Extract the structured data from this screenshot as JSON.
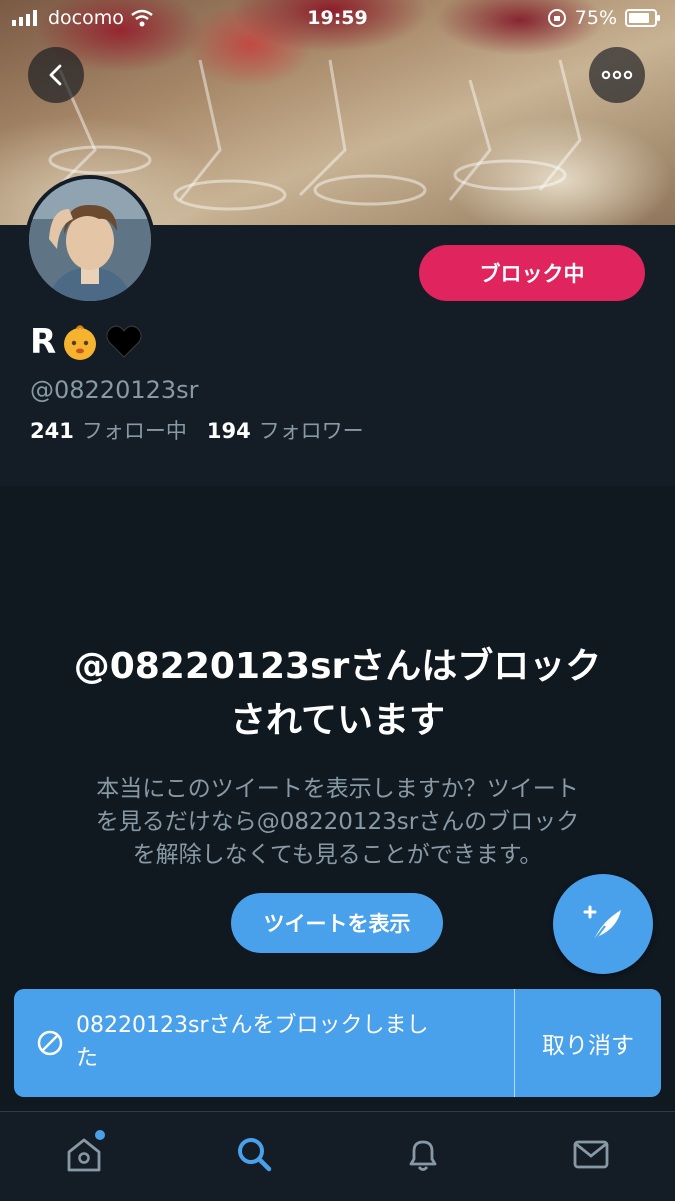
{
  "status_bar": {
    "carrier": "docomo",
    "time": "19:59",
    "battery": "75%"
  },
  "profile": {
    "name": "R",
    "handle": "@08220123sr",
    "following_count": "241",
    "following_label": "フォロー中",
    "followers_count": "194",
    "followers_label": "フォロワー",
    "block_button_label": "ブロック中"
  },
  "blocked_notice": {
    "headline_line1": "@08220123srさんはブロック",
    "headline_line2": "されています",
    "description_line1": "本当にこのツイートを表示しますか？ツイート",
    "description_line2": "を見るだけなら@08220123srさんのブロック",
    "description_line3": "を解除しなくても見ることができます。",
    "view_tweets_label": "ツイートを表示"
  },
  "toast": {
    "message_line1": "08220123srさんをブロックしまし",
    "message_line2": "た",
    "undo_label": "取り消す"
  },
  "colors": {
    "background": "#141d26",
    "accent": "#4aa1eb",
    "block": "#e0245e",
    "muted_text": "#8899a6"
  },
  "icons": {
    "back": "chevron-left-icon",
    "more": "more-horizontal-icon",
    "compose": "compose-feather-icon",
    "blocked": "no-entry-icon",
    "home": "home-icon",
    "search": "search-icon",
    "notifications": "bell-icon",
    "messages": "mail-icon"
  }
}
